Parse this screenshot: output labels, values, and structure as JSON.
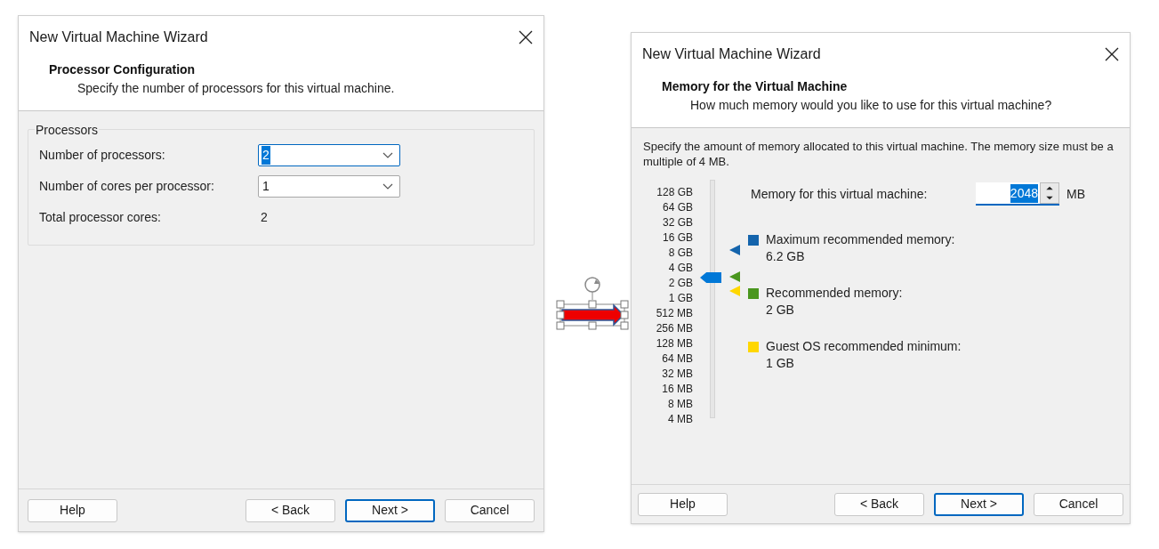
{
  "left_dialog": {
    "title": "New Virtual Machine Wizard",
    "heading": "Processor Configuration",
    "subheading": "Specify the number of processors for this virtual machine.",
    "group": {
      "title": "Processors",
      "fields": [
        {
          "kind": "dropdown",
          "label": "Number of processors:",
          "value": "2",
          "focused": true
        },
        {
          "kind": "dropdown",
          "label": "Number of cores per processor:",
          "value": "1",
          "focused": false
        },
        {
          "kind": "text",
          "label": "Total processor cores:",
          "value": "2"
        }
      ]
    },
    "buttons": [
      {
        "label": "Help",
        "default": false
      },
      {
        "label": "< Back",
        "default": false
      },
      {
        "label": "Next >",
        "default": true
      },
      {
        "label": "Cancel",
        "default": false
      }
    ]
  },
  "right_dialog": {
    "title": "New Virtual Machine Wizard",
    "heading": "Memory for the Virtual Machine",
    "subheading": "How much memory would you like to use for this virtual machine?",
    "description": "Specify the amount of memory allocated to this virtual machine. The memory size must be a multiple of 4 MB.",
    "scale": [
      "128 GB",
      "64 GB",
      "32 GB",
      "16 GB",
      "8 GB",
      "4 GB",
      "2 GB",
      "1 GB",
      "512 MB",
      "256 MB",
      "128 MB",
      "64 MB",
      "32 MB",
      "16 MB",
      "8 MB",
      "4 MB"
    ],
    "slider": {
      "level": 0.6
    },
    "memory_field": {
      "label": "Memory for this virtual machine:",
      "value": "2048",
      "unit": "MB",
      "focused": true
    },
    "recommendations": [
      {
        "label": "Maximum recommended memory:",
        "value": "6.2 GB",
        "color": "#1464ac"
      },
      {
        "label": "Recommended memory:",
        "value": "2 GB",
        "color": "#4a961e"
      },
      {
        "label": "Guest OS recommended minimum:",
        "value": "1 GB",
        "color": "#ffd700"
      }
    ],
    "buttons": [
      {
        "label": "Help",
        "default": false
      },
      {
        "label": "< Back",
        "default": false
      },
      {
        "label": "Next >",
        "default": true
      },
      {
        "label": "Cancel",
        "default": false
      }
    ]
  }
}
